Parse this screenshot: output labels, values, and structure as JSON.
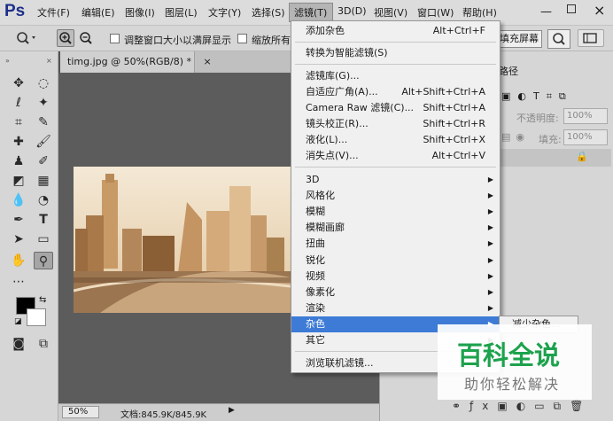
{
  "app": {
    "logo": "Ps"
  },
  "menubar": {
    "items": [
      "文件(F)",
      "编辑(E)",
      "图像(I)",
      "图层(L)",
      "文字(Y)",
      "选择(S)",
      "滤镜(T)",
      "3D(D)",
      "视图(V)",
      "窗口(W)",
      "帮助(H)"
    ],
    "active_item": "滤镜(T)"
  },
  "window_controls": {
    "minimize": "—",
    "close": "×"
  },
  "options_bar": {
    "resize_windows_label": "调整窗口大小以满屏显示",
    "zoom_all_label": "缩放所有",
    "fill_screen_label": "填充屏幕"
  },
  "document": {
    "tab_title": "timg.jpg @ 50%(RGB/8) *",
    "close": "×"
  },
  "statusbar": {
    "zoom": "50%",
    "doc_info": "文档:845.9K/845.9K"
  },
  "right_panel": {
    "tab_label": "路径",
    "opacity_label": "不透明度:",
    "opacity_value": "100%",
    "fill_label": "填充:",
    "fill_value": "100%"
  },
  "filter_menu": {
    "items": [
      {
        "label": "添加杂色",
        "shortcut": "Alt+Ctrl+F"
      },
      {
        "label": "转换为智能滤镜(S)"
      },
      {
        "label": "滤镜库(G)..."
      },
      {
        "label": "自适应广角(A)...",
        "shortcut": "Alt+Shift+Ctrl+A"
      },
      {
        "label": "Camera Raw 滤镜(C)...",
        "shortcut": "Shift+Ctrl+A"
      },
      {
        "label": "镜头校正(R)...",
        "shortcut": "Shift+Ctrl+R"
      },
      {
        "label": "液化(L)...",
        "shortcut": "Shift+Ctrl+X"
      },
      {
        "label": "消失点(V)...",
        "shortcut": "Alt+Ctrl+V"
      },
      {
        "label": "3D",
        "submenu": true
      },
      {
        "label": "风格化",
        "submenu": true
      },
      {
        "label": "模糊",
        "submenu": true
      },
      {
        "label": "模糊画廊",
        "submenu": true
      },
      {
        "label": "扭曲",
        "submenu": true
      },
      {
        "label": "锐化",
        "submenu": true
      },
      {
        "label": "视频",
        "submenu": true
      },
      {
        "label": "像素化",
        "submenu": true
      },
      {
        "label": "渲染",
        "submenu": true
      },
      {
        "label": "杂色",
        "submenu": true,
        "highlighted": true
      },
      {
        "label": "其它",
        "submenu": true
      },
      {
        "label": "浏览联机滤镜..."
      }
    ]
  },
  "submenu": {
    "first_item": "减少杂色..."
  },
  "watermark": {
    "title": "百科全说",
    "subtitle": "助你轻松解决"
  },
  "colors": {
    "highlight": "#3d7bd6",
    "watermark_green": "#1da24d",
    "canvas_bg": "#5c5c5c"
  }
}
